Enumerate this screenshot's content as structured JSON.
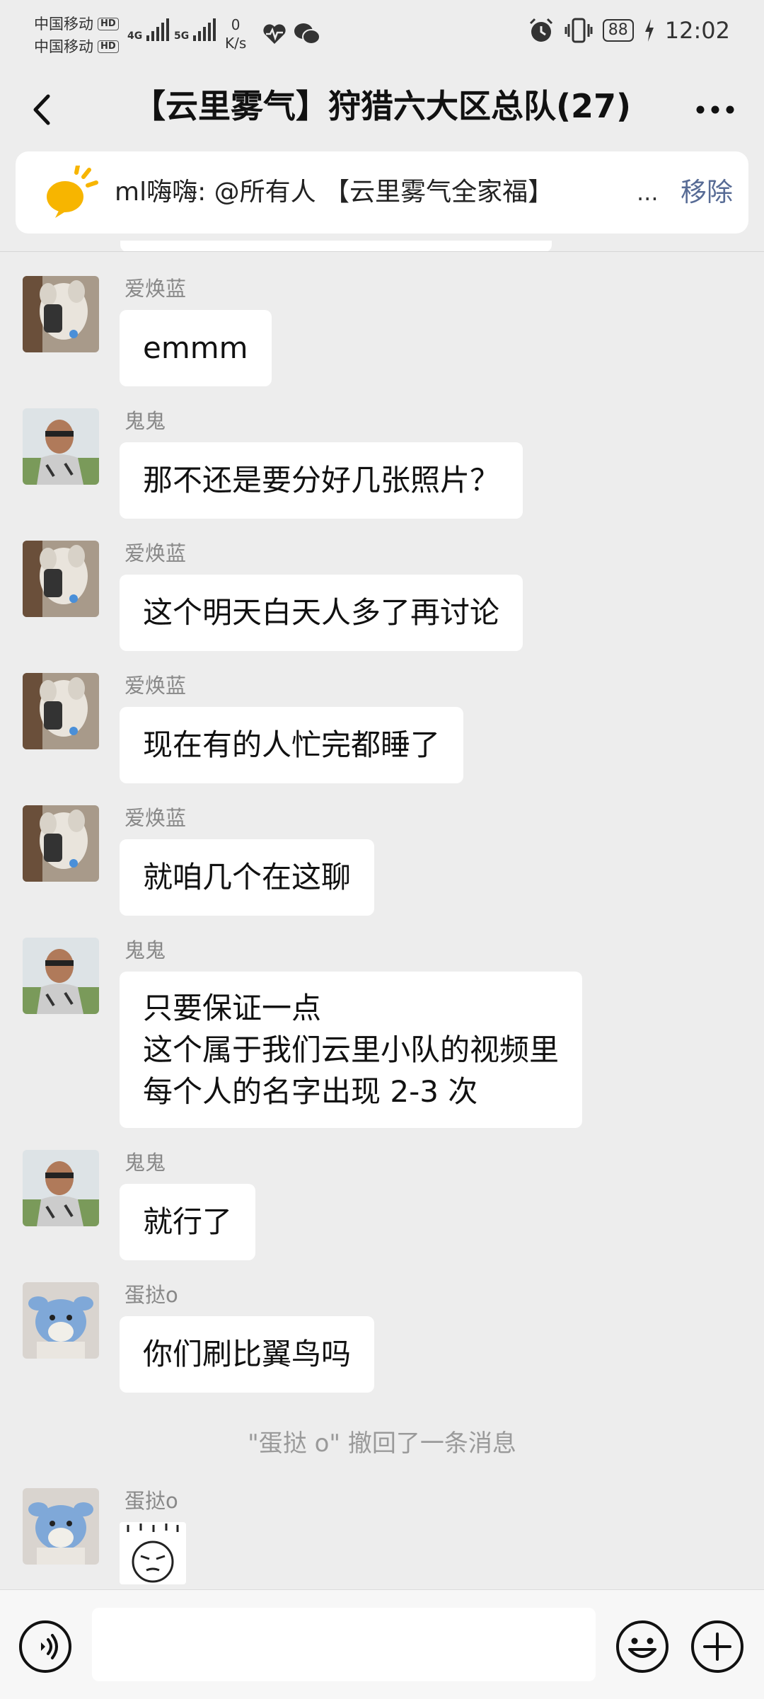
{
  "status_bar": {
    "carrier_1": "中国移动",
    "carrier_2": "中国移动",
    "hd_label": "HD",
    "net_1": "4G",
    "net_2": "5G",
    "speed_value": "0",
    "speed_unit": "K/s",
    "battery": "88",
    "time": "12:02",
    "icons": [
      "heartbeat-icon",
      "wechat-icon",
      "alarm-icon",
      "vibrate-icon",
      "charging-icon"
    ]
  },
  "header": {
    "title": "【云里雾气】狩猎六大区总队(27)",
    "back_icon": "chevron-left-icon",
    "more_icon": "more-dots-icon"
  },
  "notice": {
    "icon": "megaphone-icon",
    "text": "ml嗨嗨: @所有人 【云里雾气全家福】",
    "ellipsis": "...",
    "remove": "移除",
    "accent": "#576b95"
  },
  "messages": [
    {
      "sender": "爱焕蓝",
      "avatar": "plush-toy-avatar",
      "lines": [
        "emmm"
      ]
    },
    {
      "sender": "鬼鬼",
      "avatar": "person-photo-avatar",
      "lines": [
        "那不还是要分好几张照片？"
      ]
    },
    {
      "sender": "爱焕蓝",
      "avatar": "plush-toy-avatar",
      "lines": [
        "这个明天白天人多了再讨论"
      ]
    },
    {
      "sender": "爱焕蓝",
      "avatar": "plush-toy-avatar",
      "lines": [
        "现在有的人忙完都睡了"
      ]
    },
    {
      "sender": "爱焕蓝",
      "avatar": "plush-toy-avatar",
      "lines": [
        "就咱几个在这聊"
      ]
    },
    {
      "sender": "鬼鬼",
      "avatar": "person-photo-avatar",
      "lines": [
        "只要保证一点",
        "这个属于我们云里小队的视频里",
        "每个人的名字出现 2-3 次"
      ]
    },
    {
      "sender": "鬼鬼",
      "avatar": "person-photo-avatar",
      "lines": [
        "就行了"
      ]
    },
    {
      "sender": "蛋挞o",
      "avatar": "blue-plush-avatar",
      "lines": [
        "你们刷比翼鸟吗"
      ]
    },
    {
      "sender": "蛋挞o",
      "avatar": "blue-plush-avatar",
      "sticker": "sweating-face-sticker"
    }
  ],
  "system_message": "\"蛋挞 o\" 撤回了一条消息",
  "input_bar": {
    "voice_icon": "voice-icon",
    "placeholder": "",
    "emoji_icon": "emoji-icon",
    "plus_icon": "plus-icon"
  }
}
